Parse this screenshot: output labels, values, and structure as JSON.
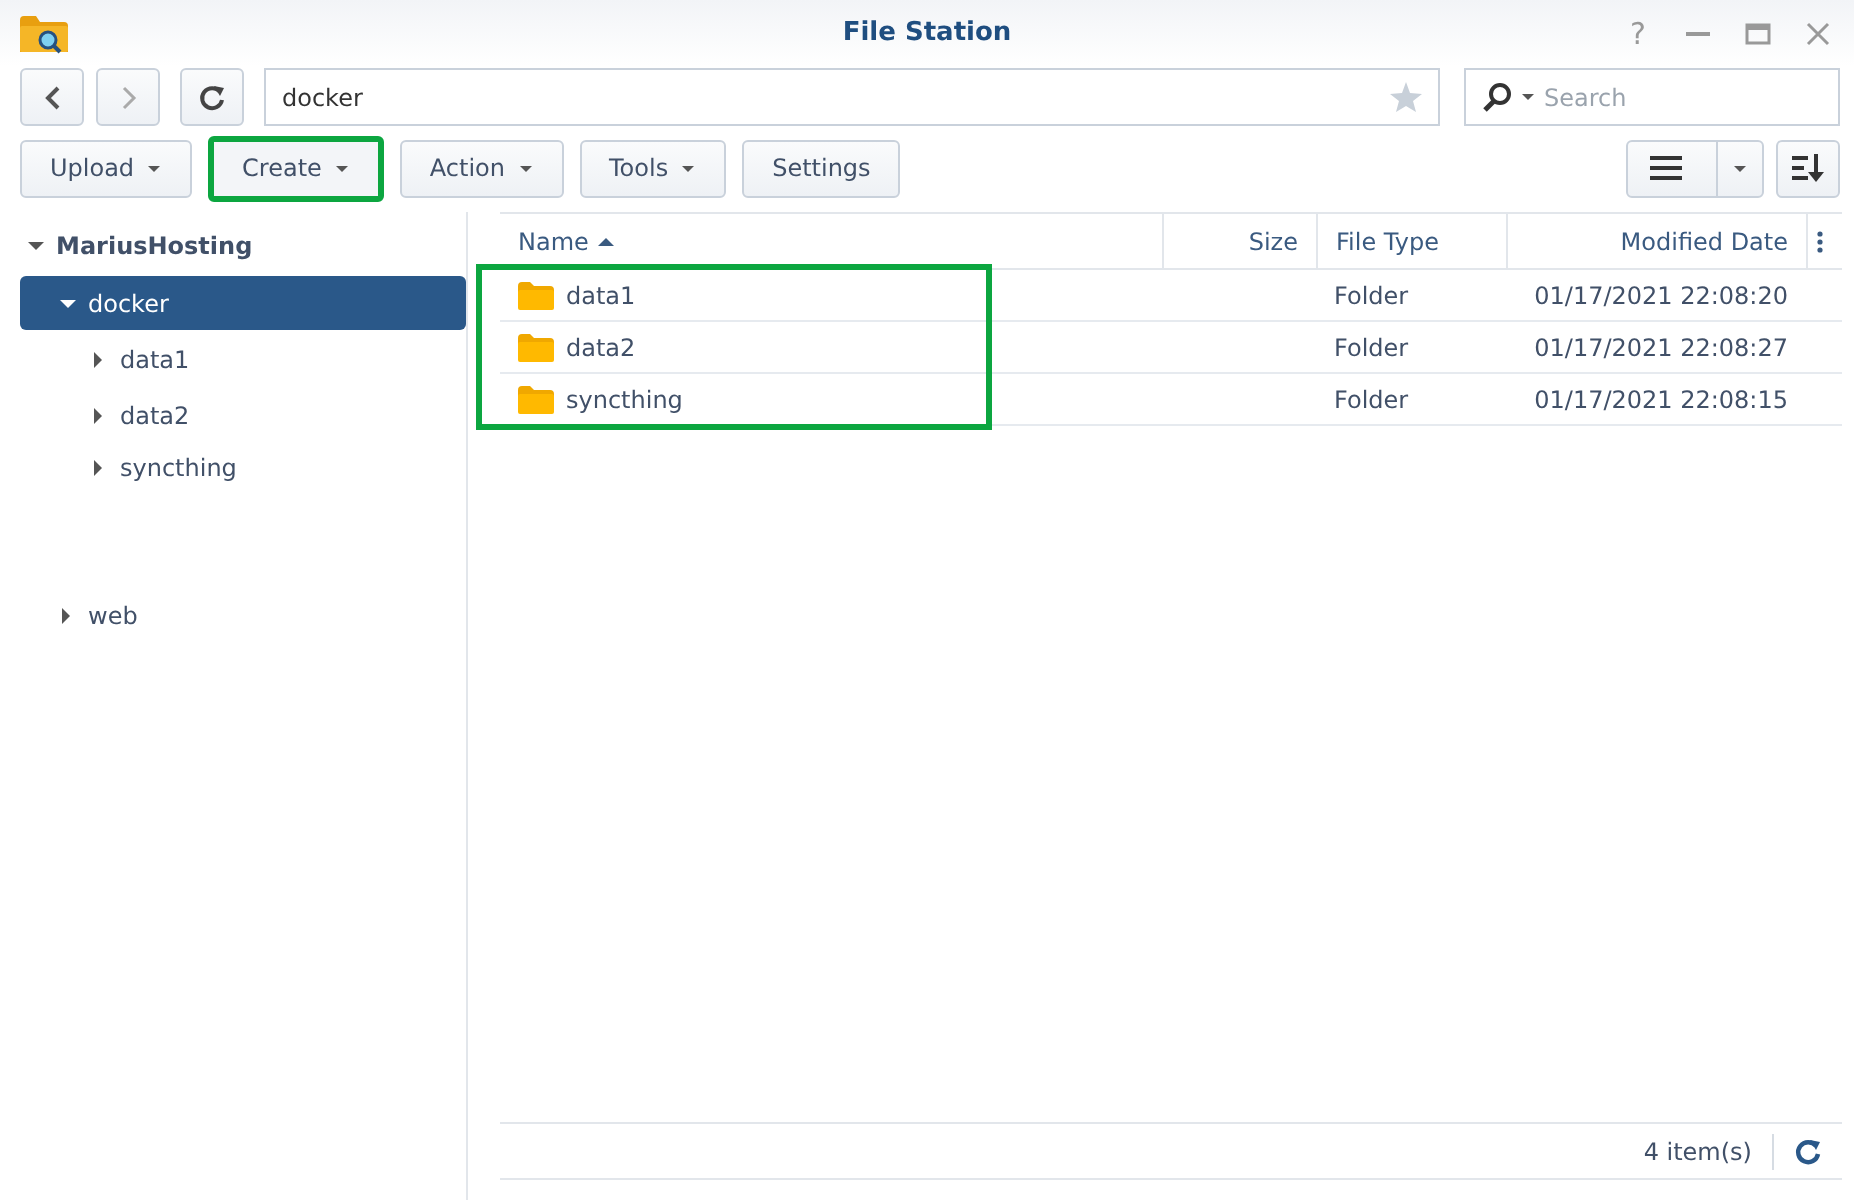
{
  "window": {
    "title": "File Station",
    "controls": [
      {
        "kind": "help",
        "label": "?"
      },
      {
        "kind": "minimize"
      },
      {
        "kind": "maximize"
      },
      {
        "kind": "close"
      }
    ]
  },
  "path_field": {
    "value": "docker"
  },
  "search": {
    "placeholder": "Search"
  },
  "toolbar": [
    {
      "label": "Upload",
      "dropdown": true,
      "highlighted": false
    },
    {
      "label": "Create",
      "dropdown": true,
      "highlighted": true
    },
    {
      "label": "Action",
      "dropdown": true,
      "highlighted": false
    },
    {
      "label": "Tools",
      "dropdown": true,
      "highlighted": false
    },
    {
      "label": "Settings",
      "dropdown": false,
      "highlighted": false
    }
  ],
  "tree": [
    {
      "label": "MariusHosting",
      "expanded": true,
      "selected": false,
      "children": [
        {
          "label": "docker",
          "expanded": true,
          "selected": true,
          "children": [
            {
              "label": "data1",
              "expanded": false,
              "selected": false
            },
            {
              "label": "data2",
              "expanded": false,
              "selected": false
            },
            {
              "label": "syncthing",
              "expanded": false,
              "selected": false
            }
          ]
        },
        {
          "label": "web",
          "expanded": false,
          "selected": false
        }
      ]
    }
  ],
  "table": {
    "columns": [
      {
        "label": "Name",
        "sorted": true
      },
      {
        "label": "Size",
        "sorted": false
      },
      {
        "label": "File Type",
        "sorted": false
      },
      {
        "label": "Modified Date",
        "sorted": false
      }
    ],
    "rows": [
      {
        "name": "data1",
        "size": "",
        "file_type": "Folder",
        "modified": "01/17/2021 22:08:20",
        "highlighted": true
      },
      {
        "name": "data2",
        "size": "",
        "file_type": "Folder",
        "modified": "01/17/2021 22:08:27",
        "highlighted": true
      },
      {
        "name": "syncthing",
        "size": "",
        "file_type": "Folder",
        "modified": "01/17/2021 22:08:15",
        "highlighted": true
      }
    ]
  },
  "status_bar": {
    "count": "4 item(s)"
  }
}
